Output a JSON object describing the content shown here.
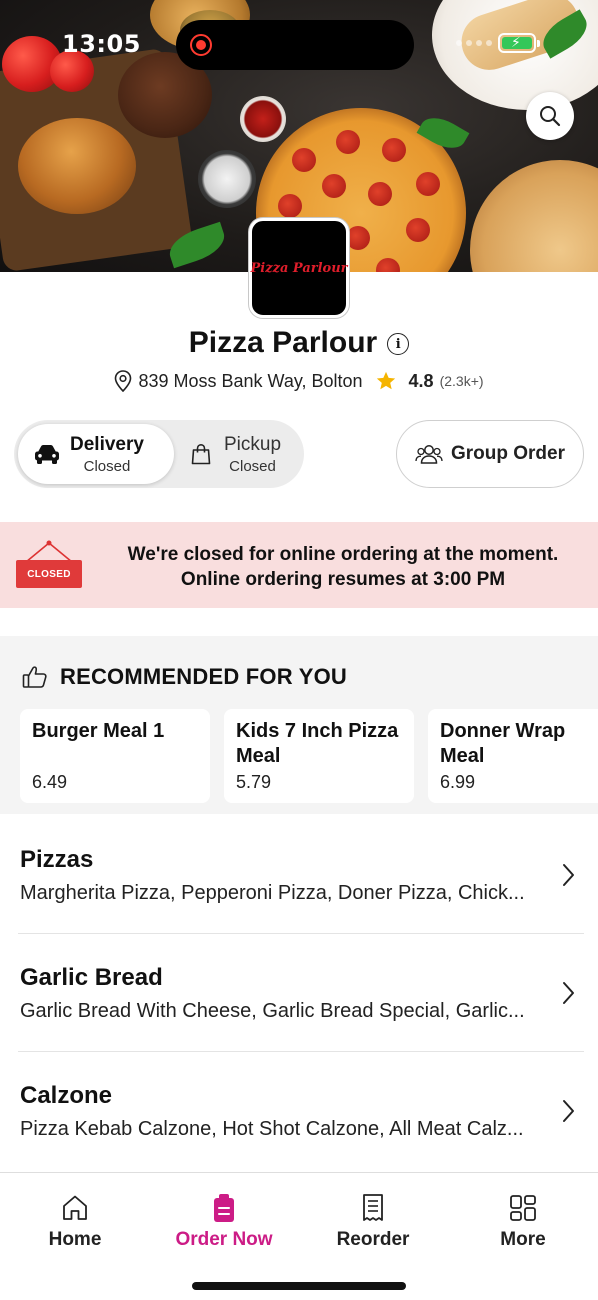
{
  "status_bar": {
    "time": "13:05"
  },
  "hero": {
    "logo_text": "Pizza Parlour",
    "search_icon": "search-icon"
  },
  "restaurant": {
    "name": "Pizza Parlour",
    "address": "839 Moss Bank Way, Bolton",
    "rating": "4.8",
    "rating_count": "(2.3k+)"
  },
  "order_modes": {
    "delivery": {
      "label": "Delivery",
      "state": "Closed"
    },
    "pickup": {
      "label": "Pickup",
      "state": "Closed"
    }
  },
  "group_order": {
    "label": "Group Order"
  },
  "closed_banner": {
    "sign_text": "CLOSED",
    "line1": "We're closed for online ordering at the moment.",
    "line2": "Online ordering resumes at 3:00 PM"
  },
  "recommended": {
    "title": "RECOMMENDED FOR YOU",
    "items": [
      {
        "name": "Burger Meal 1",
        "price": "6.49"
      },
      {
        "name": "Kids 7 Inch Pizza Meal",
        "price": "5.79"
      },
      {
        "name": "Donner Wrap Meal",
        "price": "6.99"
      }
    ]
  },
  "categories": [
    {
      "name": "Pizzas",
      "items": "Margherita Pizza, Pepperoni Pizza, Doner Pizza, Chick..."
    },
    {
      "name": "Garlic Bread",
      "items": "Garlic Bread With Cheese, Garlic Bread Special, Garlic..."
    },
    {
      "name": "Calzone",
      "items": "Pizza Kebab Calzone, Hot Shot Calzone, All Meat Calz..."
    }
  ],
  "nav": {
    "home": "Home",
    "order_now": "Order Now",
    "reorder": "Reorder",
    "more": "More",
    "active_color": "#cc1c86"
  }
}
